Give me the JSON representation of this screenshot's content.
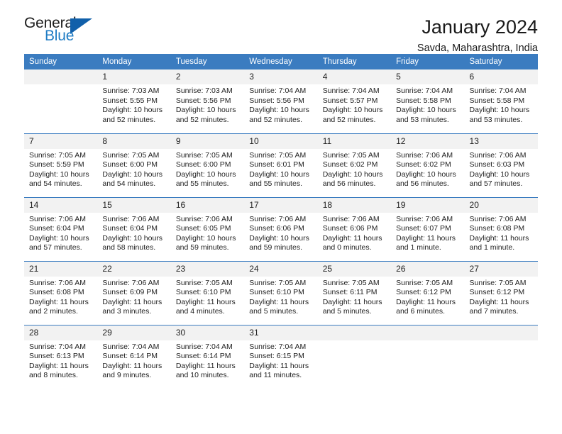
{
  "brand": {
    "name_top": "General",
    "name_bottom": "Blue",
    "accent_color": "#1f7cc4",
    "triangle_color": "#1160aa"
  },
  "header": {
    "title": "January 2024",
    "location": "Savda, Maharashtra, India"
  },
  "calendar": {
    "header_bg": "#3b7cc0",
    "daynum_bg": "#f2f2f2",
    "weekdays": [
      "Sunday",
      "Monday",
      "Tuesday",
      "Wednesday",
      "Thursday",
      "Friday",
      "Saturday"
    ],
    "weeks": [
      [
        {
          "day": "",
          "sunrise": "",
          "sunset": "",
          "daylight_line1": "",
          "daylight_line2": ""
        },
        {
          "day": "1",
          "sunrise": "Sunrise: 7:03 AM",
          "sunset": "Sunset: 5:55 PM",
          "daylight_line1": "Daylight: 10 hours",
          "daylight_line2": "and 52 minutes."
        },
        {
          "day": "2",
          "sunrise": "Sunrise: 7:03 AM",
          "sunset": "Sunset: 5:56 PM",
          "daylight_line1": "Daylight: 10 hours",
          "daylight_line2": "and 52 minutes."
        },
        {
          "day": "3",
          "sunrise": "Sunrise: 7:04 AM",
          "sunset": "Sunset: 5:56 PM",
          "daylight_line1": "Daylight: 10 hours",
          "daylight_line2": "and 52 minutes."
        },
        {
          "day": "4",
          "sunrise": "Sunrise: 7:04 AM",
          "sunset": "Sunset: 5:57 PM",
          "daylight_line1": "Daylight: 10 hours",
          "daylight_line2": "and 52 minutes."
        },
        {
          "day": "5",
          "sunrise": "Sunrise: 7:04 AM",
          "sunset": "Sunset: 5:58 PM",
          "daylight_line1": "Daylight: 10 hours",
          "daylight_line2": "and 53 minutes."
        },
        {
          "day": "6",
          "sunrise": "Sunrise: 7:04 AM",
          "sunset": "Sunset: 5:58 PM",
          "daylight_line1": "Daylight: 10 hours",
          "daylight_line2": "and 53 minutes."
        }
      ],
      [
        {
          "day": "7",
          "sunrise": "Sunrise: 7:05 AM",
          "sunset": "Sunset: 5:59 PM",
          "daylight_line1": "Daylight: 10 hours",
          "daylight_line2": "and 54 minutes."
        },
        {
          "day": "8",
          "sunrise": "Sunrise: 7:05 AM",
          "sunset": "Sunset: 6:00 PM",
          "daylight_line1": "Daylight: 10 hours",
          "daylight_line2": "and 54 minutes."
        },
        {
          "day": "9",
          "sunrise": "Sunrise: 7:05 AM",
          "sunset": "Sunset: 6:00 PM",
          "daylight_line1": "Daylight: 10 hours",
          "daylight_line2": "and 55 minutes."
        },
        {
          "day": "10",
          "sunrise": "Sunrise: 7:05 AM",
          "sunset": "Sunset: 6:01 PM",
          "daylight_line1": "Daylight: 10 hours",
          "daylight_line2": "and 55 minutes."
        },
        {
          "day": "11",
          "sunrise": "Sunrise: 7:05 AM",
          "sunset": "Sunset: 6:02 PM",
          "daylight_line1": "Daylight: 10 hours",
          "daylight_line2": "and 56 minutes."
        },
        {
          "day": "12",
          "sunrise": "Sunrise: 7:06 AM",
          "sunset": "Sunset: 6:02 PM",
          "daylight_line1": "Daylight: 10 hours",
          "daylight_line2": "and 56 minutes."
        },
        {
          "day": "13",
          "sunrise": "Sunrise: 7:06 AM",
          "sunset": "Sunset: 6:03 PM",
          "daylight_line1": "Daylight: 10 hours",
          "daylight_line2": "and 57 minutes."
        }
      ],
      [
        {
          "day": "14",
          "sunrise": "Sunrise: 7:06 AM",
          "sunset": "Sunset: 6:04 PM",
          "daylight_line1": "Daylight: 10 hours",
          "daylight_line2": "and 57 minutes."
        },
        {
          "day": "15",
          "sunrise": "Sunrise: 7:06 AM",
          "sunset": "Sunset: 6:04 PM",
          "daylight_line1": "Daylight: 10 hours",
          "daylight_line2": "and 58 minutes."
        },
        {
          "day": "16",
          "sunrise": "Sunrise: 7:06 AM",
          "sunset": "Sunset: 6:05 PM",
          "daylight_line1": "Daylight: 10 hours",
          "daylight_line2": "and 59 minutes."
        },
        {
          "day": "17",
          "sunrise": "Sunrise: 7:06 AM",
          "sunset": "Sunset: 6:06 PM",
          "daylight_line1": "Daylight: 10 hours",
          "daylight_line2": "and 59 minutes."
        },
        {
          "day": "18",
          "sunrise": "Sunrise: 7:06 AM",
          "sunset": "Sunset: 6:06 PM",
          "daylight_line1": "Daylight: 11 hours",
          "daylight_line2": "and 0 minutes."
        },
        {
          "day": "19",
          "sunrise": "Sunrise: 7:06 AM",
          "sunset": "Sunset: 6:07 PM",
          "daylight_line1": "Daylight: 11 hours",
          "daylight_line2": "and 1 minute."
        },
        {
          "day": "20",
          "sunrise": "Sunrise: 7:06 AM",
          "sunset": "Sunset: 6:08 PM",
          "daylight_line1": "Daylight: 11 hours",
          "daylight_line2": "and 1 minute."
        }
      ],
      [
        {
          "day": "21",
          "sunrise": "Sunrise: 7:06 AM",
          "sunset": "Sunset: 6:08 PM",
          "daylight_line1": "Daylight: 11 hours",
          "daylight_line2": "and 2 minutes."
        },
        {
          "day": "22",
          "sunrise": "Sunrise: 7:06 AM",
          "sunset": "Sunset: 6:09 PM",
          "daylight_line1": "Daylight: 11 hours",
          "daylight_line2": "and 3 minutes."
        },
        {
          "day": "23",
          "sunrise": "Sunrise: 7:05 AM",
          "sunset": "Sunset: 6:10 PM",
          "daylight_line1": "Daylight: 11 hours",
          "daylight_line2": "and 4 minutes."
        },
        {
          "day": "24",
          "sunrise": "Sunrise: 7:05 AM",
          "sunset": "Sunset: 6:10 PM",
          "daylight_line1": "Daylight: 11 hours",
          "daylight_line2": "and 5 minutes."
        },
        {
          "day": "25",
          "sunrise": "Sunrise: 7:05 AM",
          "sunset": "Sunset: 6:11 PM",
          "daylight_line1": "Daylight: 11 hours",
          "daylight_line2": "and 5 minutes."
        },
        {
          "day": "26",
          "sunrise": "Sunrise: 7:05 AM",
          "sunset": "Sunset: 6:12 PM",
          "daylight_line1": "Daylight: 11 hours",
          "daylight_line2": "and 6 minutes."
        },
        {
          "day": "27",
          "sunrise": "Sunrise: 7:05 AM",
          "sunset": "Sunset: 6:12 PM",
          "daylight_line1": "Daylight: 11 hours",
          "daylight_line2": "and 7 minutes."
        }
      ],
      [
        {
          "day": "28",
          "sunrise": "Sunrise: 7:04 AM",
          "sunset": "Sunset: 6:13 PM",
          "daylight_line1": "Daylight: 11 hours",
          "daylight_line2": "and 8 minutes."
        },
        {
          "day": "29",
          "sunrise": "Sunrise: 7:04 AM",
          "sunset": "Sunset: 6:14 PM",
          "daylight_line1": "Daylight: 11 hours",
          "daylight_line2": "and 9 minutes."
        },
        {
          "day": "30",
          "sunrise": "Sunrise: 7:04 AM",
          "sunset": "Sunset: 6:14 PM",
          "daylight_line1": "Daylight: 11 hours",
          "daylight_line2": "and 10 minutes."
        },
        {
          "day": "31",
          "sunrise": "Sunrise: 7:04 AM",
          "sunset": "Sunset: 6:15 PM",
          "daylight_line1": "Daylight: 11 hours",
          "daylight_line2": "and 11 minutes."
        },
        {
          "day": "",
          "sunrise": "",
          "sunset": "",
          "daylight_line1": "",
          "daylight_line2": ""
        },
        {
          "day": "",
          "sunrise": "",
          "sunset": "",
          "daylight_line1": "",
          "daylight_line2": ""
        },
        {
          "day": "",
          "sunrise": "",
          "sunset": "",
          "daylight_line1": "",
          "daylight_line2": ""
        }
      ]
    ]
  }
}
